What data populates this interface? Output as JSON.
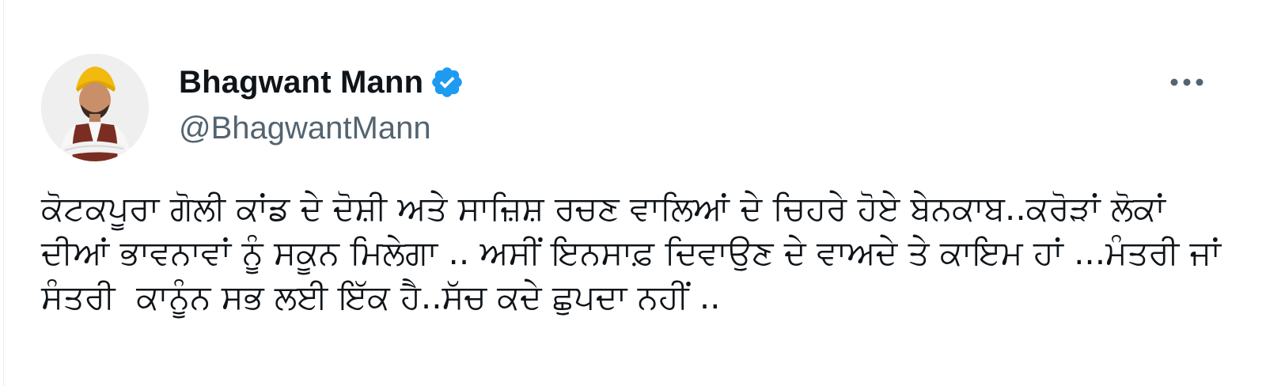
{
  "tweet": {
    "display_name": "Bhagwant Mann",
    "handle": "@BhagwantMann",
    "verified": true,
    "text": "ਕੋਟਕਪੂਰਾ ਗੋਲੀ ਕਾਂਡ ਦੇ ਦੋਸ਼ੀ ਅਤੇ ਸਾਜ਼ਿਸ਼ ਰਚਣ ਵਾਲਿਆਂ ਦੇ ਚਿਹਰੇ ਹੋਏ ਬੇਨਕਾਬ..ਕਰੋੜਾਂ ਲੋਕਾਂ ਦੀਆਂ ਭਾਵਨਾਵਾਂ ਨੂੰ ਸਕੂਨ ਮਿਲੇਗਾ .. ਅਸੀਂ ਇਨਸਾਫ਼ ਦਿਵਾਉਣ ਦੇ ਵਾਅਦੇ ਤੇ ਕਾਇਮ ਹਾਂ ...ਮੰਤਰੀ ਜਾਂ ਸੰਤਰੀ  ਕਾਨੂੰਨ ਸਭ ਲਈ ਇੱਕ ਹੈ..ਸੱਚ ਕਦੇ ਛੁਪਦਾ ਨਹੀਂ .."
  },
  "icons": {
    "verified": "verified-badge-icon",
    "more": "more-options-icon"
  },
  "colors": {
    "verified_badge": "#1d9bf0",
    "text": "#0f1419",
    "secondary_text": "#536471",
    "icon": "#536471"
  }
}
